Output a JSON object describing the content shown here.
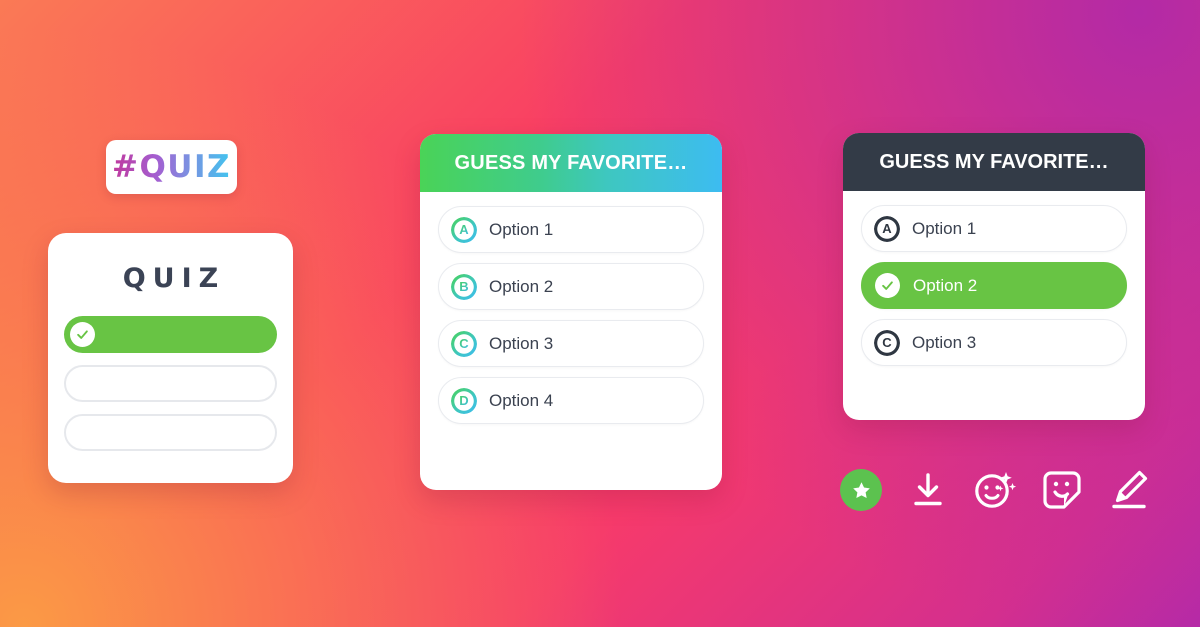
{
  "background": {
    "gradient_from": "#fb9a45",
    "gradient_mid": "#f93e63",
    "gradient_to": "#b52aa7"
  },
  "hashtag_badge": {
    "label": "#QUIZ",
    "gradient_from": "#c0399e",
    "gradient_to": "#41c5ef"
  },
  "quiz_card": {
    "title": "QUIZ",
    "title_color": "#3b4355",
    "selected_color": "#68c444",
    "bars": [
      {
        "state": "selected"
      },
      {
        "state": "empty"
      },
      {
        "state": "empty"
      }
    ]
  },
  "gradient_card": {
    "header": {
      "title": "GUESS MY FAVORITE…",
      "gradient_from": "#4ad357",
      "gradient_to": "#3dbcf1",
      "text_color": "#ffffff"
    },
    "options": [
      {
        "letter": "A",
        "label": "Option 1",
        "selected": false
      },
      {
        "letter": "B",
        "label": "Option 2",
        "selected": false
      },
      {
        "letter": "C",
        "label": "Option 3",
        "selected": false
      },
      {
        "letter": "D",
        "label": "Option 4",
        "selected": false
      }
    ]
  },
  "dark_card": {
    "header": {
      "title": "GUESS MY FAVORITE…",
      "background": "#333b47",
      "text_color": "#ffffff"
    },
    "options": [
      {
        "letter": "A",
        "label": "Option 1",
        "selected": false
      },
      {
        "letter": "",
        "label": "Option 2",
        "selected": true
      },
      {
        "letter": "C",
        "label": "Option 3",
        "selected": false
      }
    ],
    "selected_color": "#68c444"
  },
  "icon_row": {
    "icons": [
      {
        "name": "star-icon",
        "badge_color": "#5cc24f"
      },
      {
        "name": "download-icon"
      },
      {
        "name": "effects-face-sparkle-icon"
      },
      {
        "name": "sticker-face-icon"
      },
      {
        "name": "marker-pen-icon"
      }
    ]
  }
}
